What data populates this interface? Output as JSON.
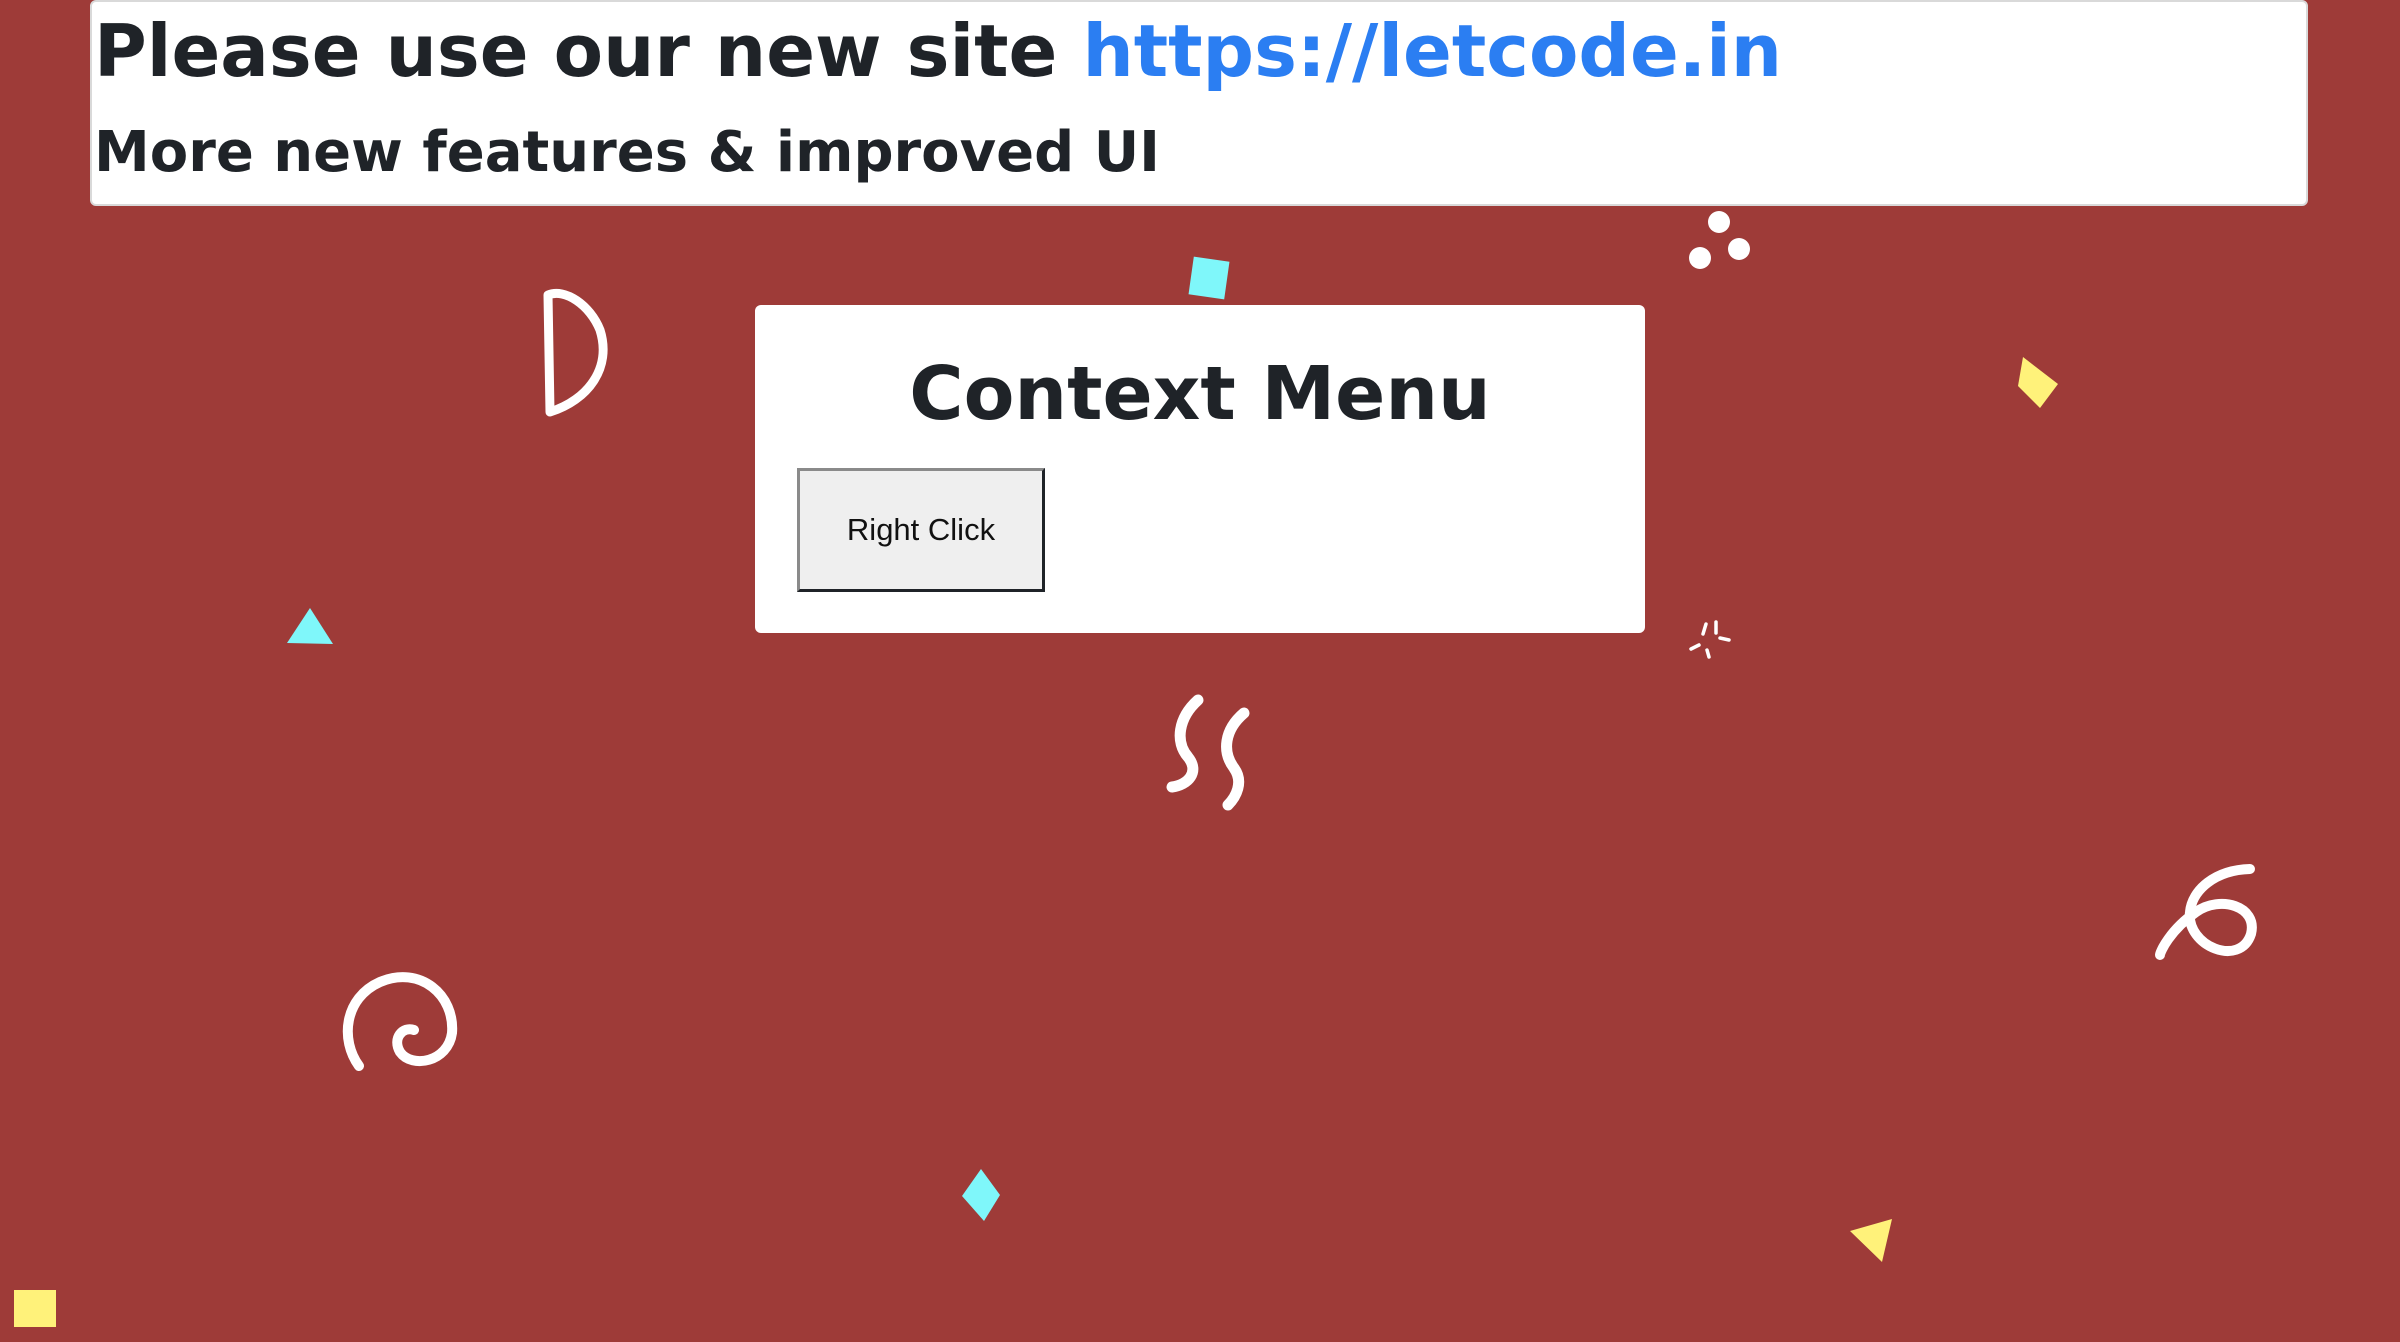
{
  "banner": {
    "prefix": "Please use our new site ",
    "link_text": "https://letcode.in",
    "subtitle": "More new features & improved UI"
  },
  "card": {
    "title": "Context Menu",
    "button_label": "Right Click"
  },
  "colors": {
    "background": "#9e3b38",
    "link": "#2b7ef2",
    "confetti_cyan": "#7ff7fa",
    "confetti_yellow": "#fff27a",
    "doodle": "#ffffff"
  }
}
